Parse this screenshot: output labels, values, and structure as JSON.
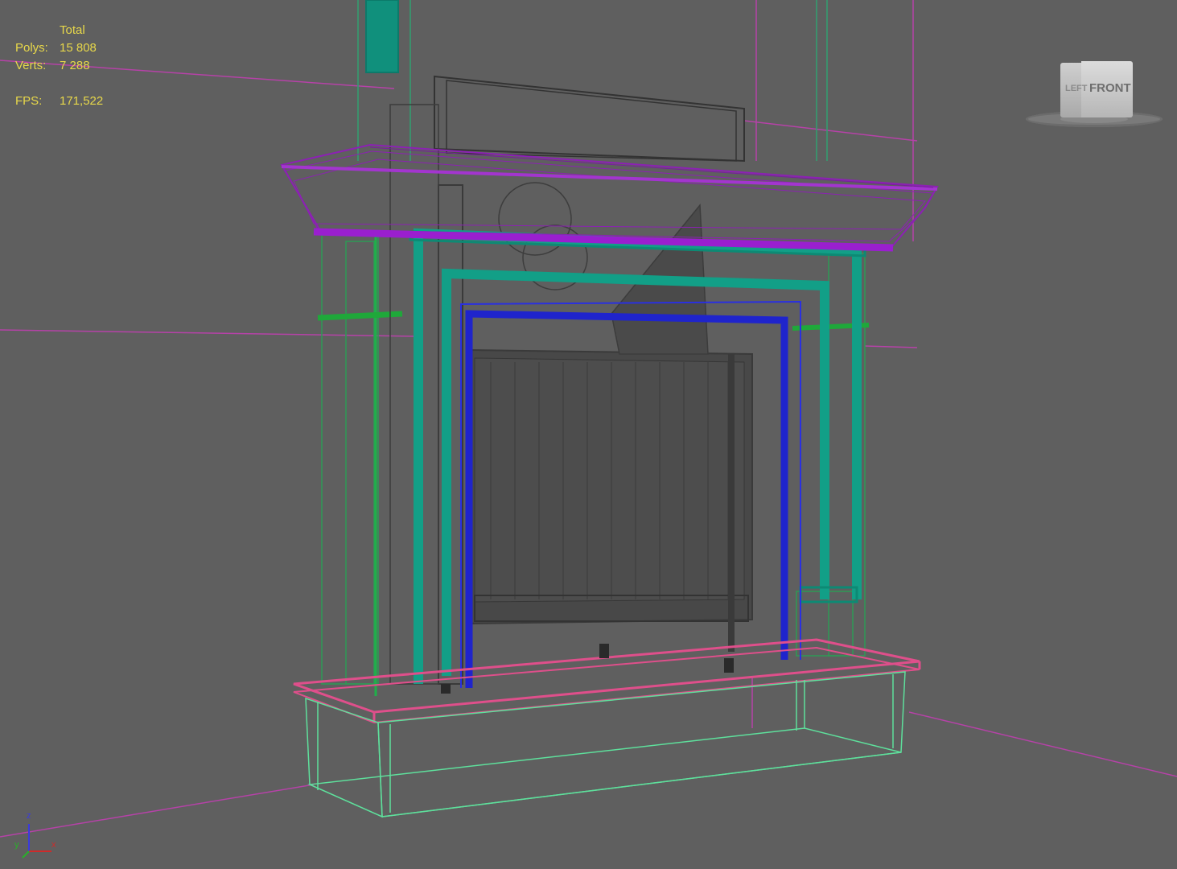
{
  "stats": {
    "header": "Total",
    "polys_label": "Polys:",
    "polys_value": "15 808",
    "verts_label": "Verts:",
    "verts_value": "7 288",
    "fps_label": "FPS:",
    "fps_value": "171,522"
  },
  "viewcube": {
    "front_label": "FRONT",
    "left_label": "LEFT"
  },
  "axis": {
    "z_label": "z",
    "x_label": "x",
    "y_label": "y"
  },
  "colors": {
    "background": "#5f5f5f",
    "stats_text": "#e8d84a",
    "mantel_shelf": "#8b1fb0",
    "surround": "#0f9a82",
    "inner_frame": "#1a22d0",
    "hearth_top": "#e0508c",
    "hearth_base": "#5ee0a0",
    "room_lines": "#c040b0"
  }
}
